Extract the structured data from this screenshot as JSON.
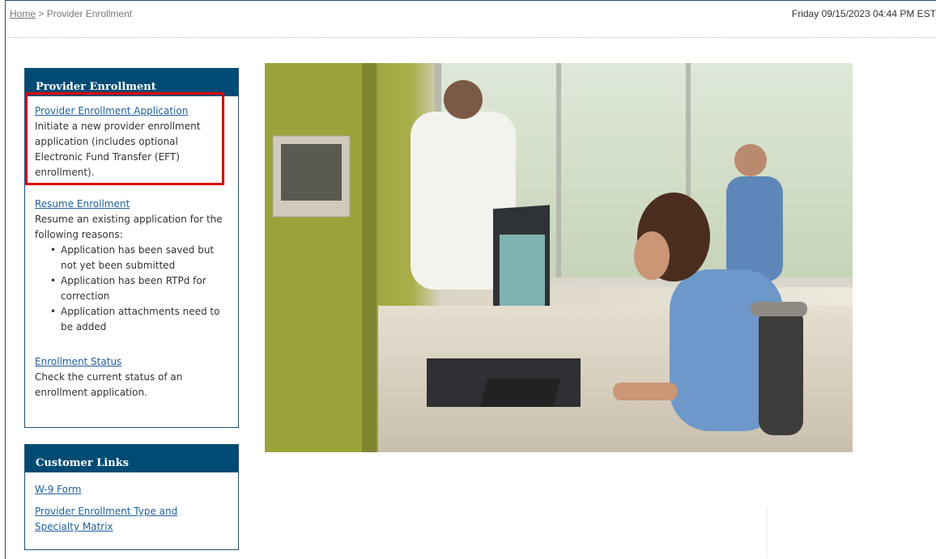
{
  "breadcrumb": {
    "home": "Home",
    "separator": ">",
    "current": "Provider Enrollment"
  },
  "datetime": "Friday 09/15/2023 04:44 PM EST",
  "enrollment_panel": {
    "title": "Provider Enrollment",
    "application": {
      "link": "Provider Enrollment Application",
      "description": "Initiate a new provider enrollment application (includes optional Electronic Fund Transfer (EFT) enrollment)."
    },
    "resume": {
      "link": "Resume Enrollment",
      "description": "Resume an existing application for the following reasons:",
      "reasons": [
        "Application has been saved but not yet been submitted",
        "Application has been RTPd for correction",
        "Application attachments need to be added"
      ]
    },
    "status": {
      "link": "Enrollment Status",
      "description": "Check the current status of an enrollment application."
    }
  },
  "customer_links": {
    "title": "Customer Links",
    "links": [
      "W-9 Form",
      "Provider Enrollment Type and Specialty Matrix"
    ]
  },
  "colors": {
    "header_bg": "#004b73",
    "link": "#1f5f9a",
    "highlight": "#e00000"
  },
  "icons": {
    "hero": "healthcare-workstation-photo"
  }
}
